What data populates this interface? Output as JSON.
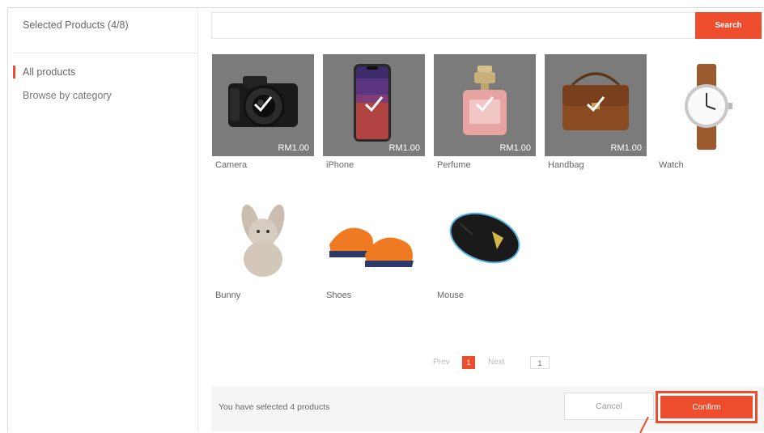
{
  "sidebar": {
    "selected_title": "Selected Products (4/8)",
    "items": [
      {
        "label": "All products",
        "active": true
      },
      {
        "label": "Browse by category",
        "active": false
      }
    ]
  },
  "search": {
    "value": "",
    "placeholder": "",
    "button_label": "Search"
  },
  "products": [
    {
      "name": "Camera",
      "price": "RM1.00",
      "selected": true,
      "icon": "camera-icon"
    },
    {
      "name": "iPhone",
      "price": "RM1.00",
      "selected": true,
      "icon": "phone-icon"
    },
    {
      "name": "Perfume",
      "price": "RM1.00",
      "selected": true,
      "icon": "perfume-icon"
    },
    {
      "name": "Handbag",
      "price": "RM1.00",
      "selected": true,
      "icon": "handbag-icon"
    },
    {
      "name": "Watch",
      "price": "",
      "selected": false,
      "icon": "watch-icon"
    },
    {
      "name": "Bunny",
      "price": "",
      "selected": false,
      "icon": "bunny-icon"
    },
    {
      "name": "Shoes",
      "price": "",
      "selected": false,
      "icon": "shoes-icon"
    },
    {
      "name": "Mouse",
      "price": "",
      "selected": false,
      "icon": "mouse-icon"
    }
  ],
  "pagination": {
    "prev_label": "Prev",
    "current_page": "1",
    "next_label": "Next",
    "page_input": "1"
  },
  "footer": {
    "status_text": "You have selected 4 products",
    "cancel_label": "Cancel",
    "confirm_label": "Confirm"
  },
  "colors": {
    "accent": "#ee4d2d",
    "selected_overlay": "#7b7b7b"
  }
}
